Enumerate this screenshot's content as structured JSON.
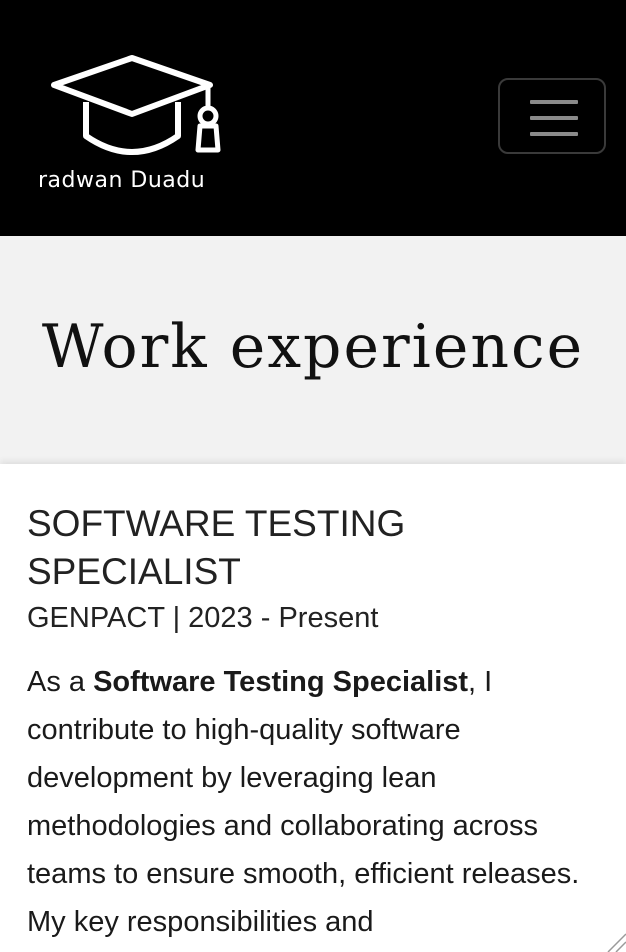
{
  "header": {
    "brand": "radwan Duadu",
    "logo_icon": "graduation-cap-icon",
    "menu_icon": "hamburger-menu-icon",
    "background": "#000000"
  },
  "hero": {
    "title": "Work experience",
    "background": "#f2f2f2"
  },
  "experience": {
    "job_title": "SOFTWARE TESTING SPECIALIST",
    "company_period": "GENPACT | 2023 - Present",
    "description_prefix": "As a ",
    "description_bold": "Software Testing Specialist",
    "description_rest": ", I contribute to high-quality software development by leveraging lean methodologies and collaborating across teams to ensure smooth, efficient releases. My key responsibilities and"
  }
}
